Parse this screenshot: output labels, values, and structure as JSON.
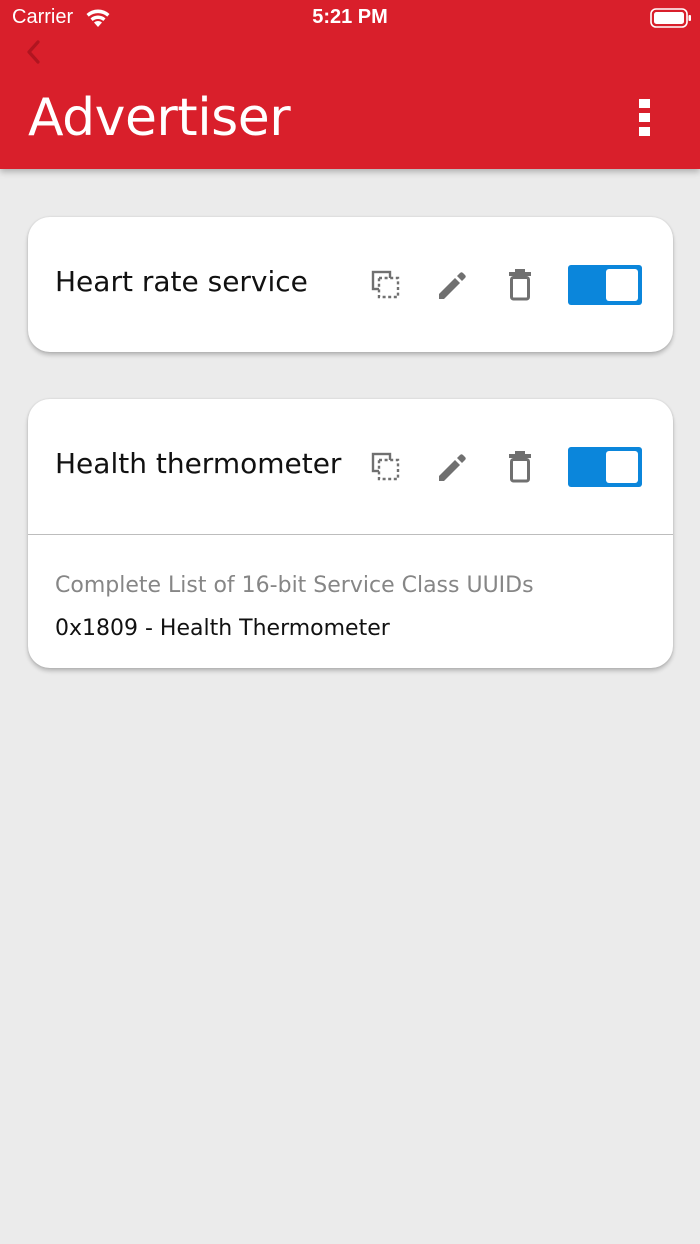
{
  "status_bar": {
    "carrier": "Carrier",
    "time": "5:21 PM",
    "wifi_icon": "wifi-icon",
    "battery_icon": "battery-icon"
  },
  "header": {
    "title": "Advertiser",
    "back_icon": "chevron-left-icon",
    "menu_icon": "more-vertical-icon",
    "background_color": "#d91f2b"
  },
  "advertisers": [
    {
      "name": "Heart rate service",
      "enabled": true,
      "actions": [
        "copy-icon",
        "edit-icon",
        "delete-icon"
      ],
      "details": []
    },
    {
      "name": "Health thermometer",
      "enabled": true,
      "actions": [
        "copy-icon",
        "edit-icon",
        "delete-icon"
      ],
      "details": [
        {
          "label": "Complete List of 16-bit Service Class UUIDs",
          "value": "0x1809 - Health Thermometer"
        }
      ]
    }
  ],
  "colors": {
    "accent": "#d91f2b",
    "toggle_on": "#0b86db",
    "background": "#ebebeb"
  }
}
